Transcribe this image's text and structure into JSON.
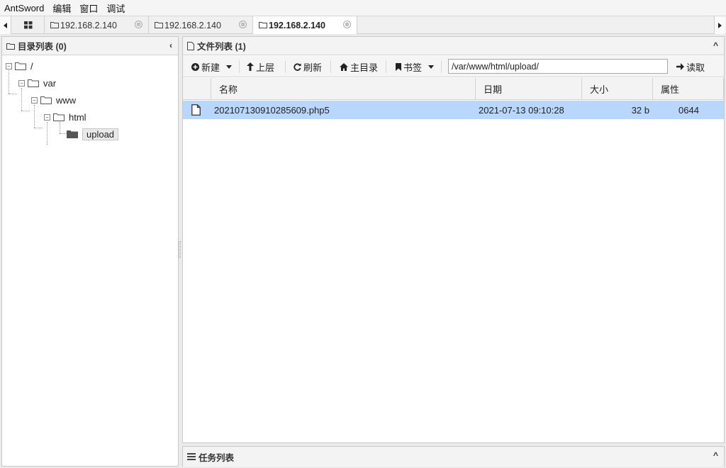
{
  "menu": {
    "items": [
      "AntSword",
      "编辑",
      "窗口",
      "调试"
    ]
  },
  "tabs": {
    "items": [
      {
        "label": "192.168.2.140",
        "active": false
      },
      {
        "label": "192.168.2.140",
        "active": false
      },
      {
        "label": "192.168.2.140",
        "active": true
      }
    ],
    "close_glyph": "⊗",
    "scroll_left_icon": "caret-left-icon",
    "scroll_right_icon": "caret-right-icon",
    "home_icon": "grid-icon"
  },
  "dir_panel": {
    "title": "目录列表 (0)",
    "collapse_glyph": "‹",
    "tree": [
      {
        "label": "/",
        "expanded": true,
        "selected": false
      },
      {
        "label": "var",
        "expanded": true,
        "selected": false
      },
      {
        "label": "www",
        "expanded": true,
        "selected": false
      },
      {
        "label": "html",
        "expanded": true,
        "selected": false
      },
      {
        "label": "upload",
        "expanded": false,
        "selected": true
      }
    ],
    "expand_glyph": "−"
  },
  "file_panel": {
    "title": "文件列表 (1)",
    "collapse_glyph": "^",
    "toolbar": {
      "new_label": "新建",
      "up_label": "上层",
      "refresh_label": "刷新",
      "home_label": "主目录",
      "bookmark_label": "书签",
      "path_value": "/var/www/html/upload/",
      "read_label": "读取"
    },
    "columns": [
      "名称",
      "日期",
      "大小",
      "属性"
    ],
    "rows": [
      {
        "name": "20210713091028​5609.php5",
        "date": "2021-07-13 09:10:28",
        "size": "32 b",
        "perm": "0644",
        "selected": true
      }
    ]
  },
  "task_panel": {
    "title": "任务列表",
    "collapse_glyph": "^"
  },
  "colors": {
    "selection": "#b9d7fc",
    "panel_header": "#f3f3f3",
    "background": "#ebebeb"
  }
}
